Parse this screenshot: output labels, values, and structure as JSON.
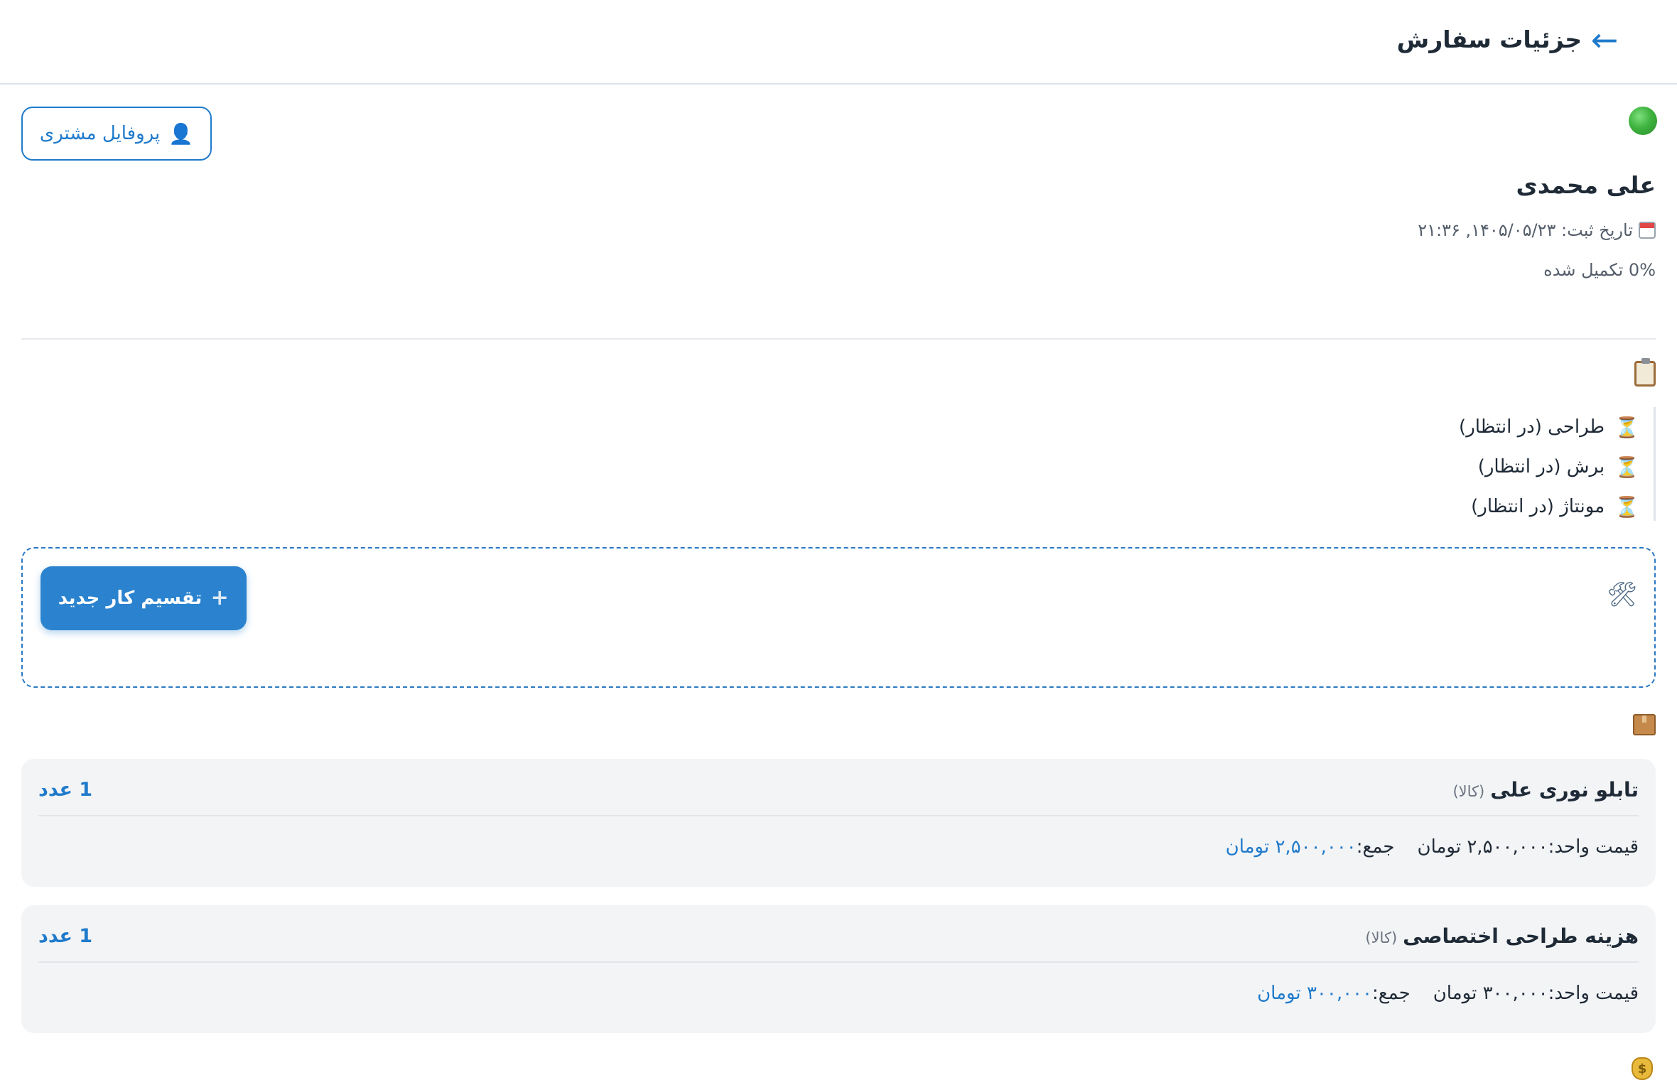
{
  "header": {
    "title": "جزئیات سفارش",
    "back_icon": "arrow-left-icon"
  },
  "customer": {
    "status_icon": "green-circle-icon",
    "status_color": "#3fb33f",
    "name": "علی محمدی",
    "profile_button_label": "پروفایل مشتری",
    "profile_button_icon": "person-icon",
    "registration_date_text": "تاریخ ثبت: ۱۴۰۵/۰۵/۲۳, ۲۱:۳۶",
    "progress_text": "0% تکمیل شده",
    "progress_percent": 0
  },
  "steps": [
    {
      "label": "طراحی (در انتظار)",
      "icon": "hourglass-icon"
    },
    {
      "label": "برش (در انتظار)",
      "icon": "hourglass-icon"
    },
    {
      "label": "مونتاژ (در انتظار)",
      "icon": "hourglass-icon"
    }
  ],
  "tasks": {
    "icon": "tools-icon",
    "new_task_button_label": "تقسیم کار جدید",
    "new_task_button_icon": "plus-icon",
    "accent_color": "#2b83cf"
  },
  "items": [
    {
      "title": "تابلو نوری علی",
      "type": "(کالا)",
      "quantity": "1 عدد",
      "unit_price": "قیمت واحد:۲,۵۰۰,۰۰۰ تومان",
      "total_label": "جمع:",
      "total_value": "۲,۵۰۰,۰۰۰ تومان"
    },
    {
      "title": "هزینه طراحی اختصاصی",
      "type": "(کالا)",
      "quantity": "1 عدد",
      "unit_price": "قیمت واحد:۳۰۰,۰۰۰ تومان",
      "total_label": "جمع:",
      "total_value": "۳۰۰,۰۰۰ تومان"
    }
  ],
  "sections": {
    "steps_icon": "clipboard-icon",
    "items_icon": "package-icon",
    "payments_icon": "money-bag-icon"
  }
}
